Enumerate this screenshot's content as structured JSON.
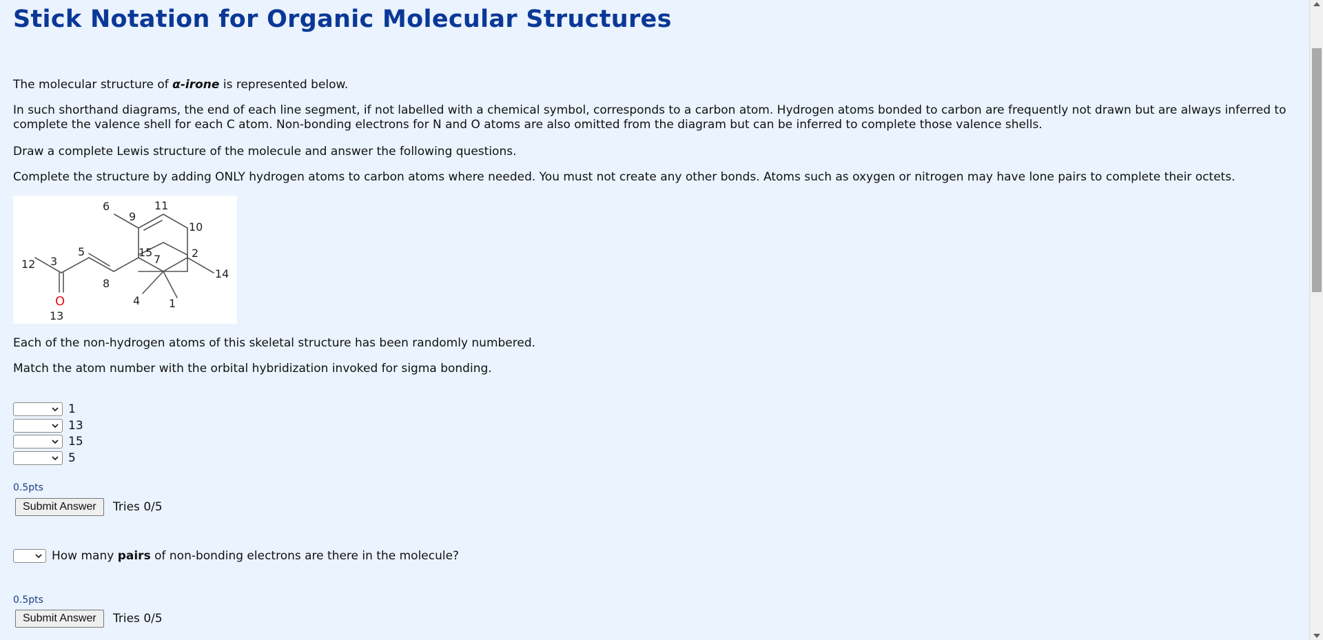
{
  "title": "Stick Notation for Organic Molecular Structures",
  "intro": {
    "prefix": "The molecular structure of ",
    "molecule_name": "α-irone",
    "suffix": " is represented below."
  },
  "paragraph_shorthand_line1": "In such shorthand diagrams, the end of each line segment, if not labelled with a chemical symbol, corresponds to a carbon atom. Hydrogen atoms bonded to carbon are frequently not drawn but are always inferred to",
  "paragraph_shorthand_line2": "complete the valence shell for each C atom. Non-bonding electrons for N and O atoms are also omitted from the diagram but can be inferred to complete those valence shells.",
  "paragraph_draw": "Draw a complete Lewis structure of the molecule and answer the following questions.",
  "paragraph_complete": "Complete the structure by adding ONLY hydrogen atoms to carbon atoms where needed. You must not create any other bonds. Atoms such as oxygen or nitrogen may have lone pairs to complete their octets.",
  "molecule_labels": {
    "a1": "1",
    "a2": "2",
    "a3": "3",
    "a4": "4",
    "a5": "5",
    "a6": "6",
    "a7": "7",
    "a8": "8",
    "a9": "9",
    "a10": "10",
    "a11": "11",
    "a12": "12",
    "a13": "13",
    "a14": "14",
    "a15": "15",
    "oxygen": "O"
  },
  "paragraph_numbered": "Each of the non-hydrogen atoms of this skeletal structure has been randomly numbered.",
  "paragraph_match": "Match the atom number with the orbital hybridization invoked for sigma bonding.",
  "match_rows": [
    {
      "label": "1"
    },
    {
      "label": "13"
    },
    {
      "label": "15"
    },
    {
      "label": "5"
    }
  ],
  "question1": {
    "points": "0.5pts",
    "submit_label": "Submit Answer",
    "tries": "Tries 0/5"
  },
  "question2": {
    "prompt_bold": "pairs",
    "prompt_prefix": "How many ",
    "prompt_suffix": " of non-bonding electrons are there in the molecule?",
    "points": "0.5pts",
    "submit_label": "Submit Answer",
    "tries": "Tries 0/5"
  },
  "colors": {
    "heading": "#0b3897",
    "background": "#eaf3fe",
    "oxygen": "#e8141a"
  },
  "icons": [
    "chevron-down-icon"
  ]
}
